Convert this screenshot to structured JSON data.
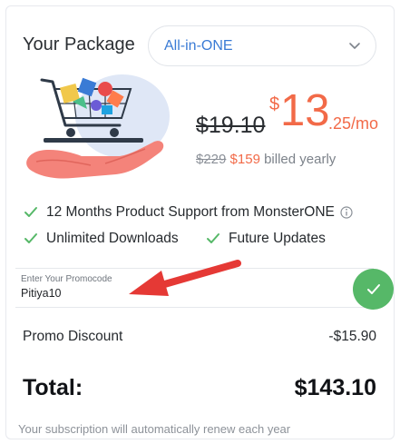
{
  "package": {
    "label": "Your Package",
    "selected": "All-in-ONE"
  },
  "pricing": {
    "old_price": "$19.10",
    "currency": "$",
    "main": "13",
    "fraction": ".25/mo",
    "billed_old": "$229",
    "billed_new": "$159",
    "billed_suffix": " billed yearly"
  },
  "features": [
    {
      "label": "12 Months Product Support from MonsterONE"
    },
    {
      "label": "Unlimited Downloads"
    },
    {
      "label": "Future Updates"
    }
  ],
  "promo": {
    "placeholder": "Enter Your Promocode",
    "value": "Pitiya10"
  },
  "summary": {
    "discount_label": "Promo Discount",
    "discount_value": "-$15.90",
    "total_label": "Total:",
    "total_value": "$143.10",
    "renew_note": "Your subscription will automatically renew each year"
  },
  "colors": {
    "accent": "#f26a48",
    "link_blue": "#3a7bd5",
    "check_green": "#56b868",
    "annotation_red": "#e53935"
  },
  "icons": [
    "chevron-down-icon",
    "check-icon",
    "info-icon",
    "shopping-cart-illustration",
    "red-arrow-annotation"
  ]
}
